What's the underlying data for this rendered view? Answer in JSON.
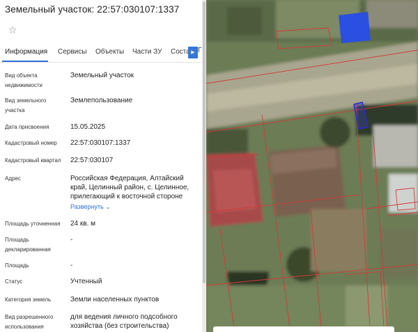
{
  "header": {
    "title": "Земельный участок: 22:57:030107:1337"
  },
  "tabs": [
    {
      "label": "Информация",
      "active": true
    },
    {
      "label": "Сервисы"
    },
    {
      "label": "Объекты"
    },
    {
      "label": "Части ЗУ"
    },
    {
      "label": "Соста"
    },
    {
      "label": "Г"
    }
  ],
  "fields": [
    {
      "label": "Вид объекта недвижимости",
      "value": "Земельный участок"
    },
    {
      "label": "Вид земельного участка",
      "value": "Землепользование"
    },
    {
      "label": "Дата присвоения",
      "value": "15.05.2025"
    },
    {
      "label": "Кадастровый номер",
      "value": "22:57:030107:1337"
    },
    {
      "label": "Кадастровый квартал",
      "value": "22:57:030107"
    },
    {
      "label": "Адрес",
      "value": "Российская Федерация, Алтайский край, Целинный район, с. Целинное, прилегающий к восточной стороне"
    },
    {
      "label": "Площадь уточненная",
      "value": "24 кв. м"
    },
    {
      "label": "Площадь декларированная",
      "value": "-"
    },
    {
      "label": "Площадь",
      "value": "-"
    },
    {
      "label": "Статус",
      "value": "Учтенный"
    },
    {
      "label": "Категория земель",
      "value": "Земли населенных пунктов"
    },
    {
      "label": "Вид разрешенного использования",
      "value": "для ведения личного подсобного хозяйства (без строительства)"
    }
  ],
  "address_expand_label": "Развернуть",
  "colors": {
    "accent": "#2f6fd6",
    "parcel_border": "#d23a3a",
    "selected_parcel": "#2a2ad8",
    "map_highlight_building": "#2b4fe0"
  }
}
